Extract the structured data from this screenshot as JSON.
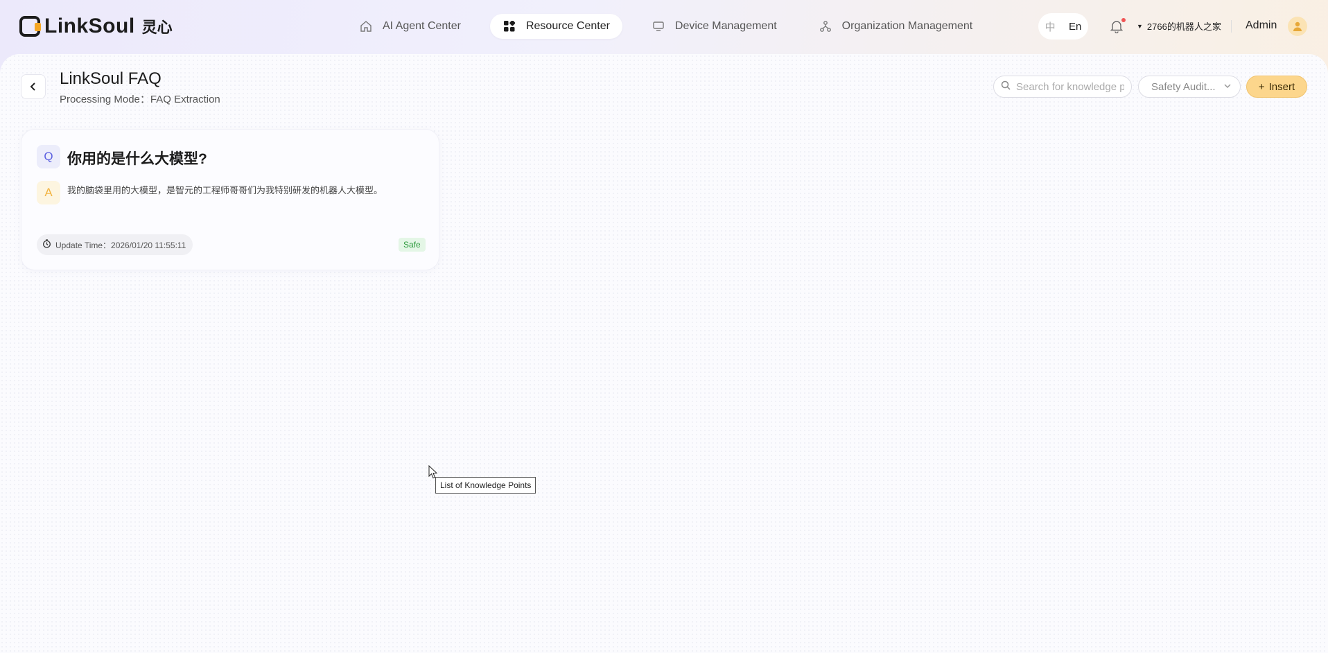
{
  "brand": {
    "name": "LinkSoul",
    "name_cn": "灵心"
  },
  "nav": {
    "items": [
      {
        "label": "AI Agent Center",
        "icon": "home-icon"
      },
      {
        "label": "Resource Center",
        "icon": "grid-icon",
        "active": true
      },
      {
        "label": "Device Management",
        "icon": "monitor-icon"
      },
      {
        "label": "Organization Management",
        "icon": "org-icon"
      }
    ]
  },
  "header_right": {
    "lang_cn": "中",
    "lang_en": "En",
    "home_name": "2766的机器人之家",
    "user": "Admin"
  },
  "page": {
    "title": "LinkSoul FAQ",
    "subtitle": "Processing Mode：FAQ Extraction",
    "search_placeholder": "Search for knowledge p",
    "safety_filter": "Safety Audit...",
    "insert_label": "Insert"
  },
  "faq": {
    "q_label": "Q",
    "a_label": "A",
    "question": "你用的是什么大模型?",
    "answer": "我的脑袋里用的大模型，是智元的工程师哥哥们为我特别研发的机器人大模型。",
    "update_time": "Update Time：2026/01/20 11:55:11",
    "status": "Safe",
    "status_color": "#2c9a3c"
  },
  "tooltip": "List of Knowledge Points",
  "colors": {
    "accent": "#fcd68c",
    "question_accent": "#5b5fe0",
    "answer_accent": "#f2b340"
  }
}
